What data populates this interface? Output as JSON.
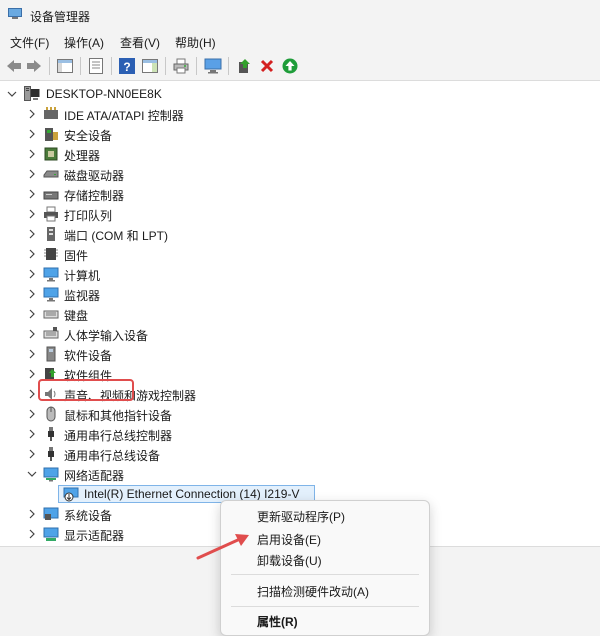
{
  "window": {
    "title": "设备管理器"
  },
  "menu": {
    "file": "文件(F)",
    "action": "操作(A)",
    "view": "查看(V)",
    "help": "帮助(H)"
  },
  "tree": {
    "root": "DESKTOP-NN0EE8K",
    "items": [
      {
        "label": "IDE ATA/ATAPI 控制器",
        "icon": "ide-controller-icon"
      },
      {
        "label": "安全设备",
        "icon": "security-device-icon"
      },
      {
        "label": "处理器",
        "icon": "processor-icon"
      },
      {
        "label": "磁盘驱动器",
        "icon": "disk-drive-icon"
      },
      {
        "label": "存储控制器",
        "icon": "storage-controller-icon"
      },
      {
        "label": "打印队列",
        "icon": "printer-icon"
      },
      {
        "label": "端口 (COM 和 LPT)",
        "icon": "port-icon"
      },
      {
        "label": "固件",
        "icon": "firmware-icon"
      },
      {
        "label": "计算机",
        "icon": "computer-icon"
      },
      {
        "label": "监视器",
        "icon": "monitor-icon"
      },
      {
        "label": "键盘",
        "icon": "keyboard-icon"
      },
      {
        "label": "人体学输入设备",
        "icon": "hid-icon"
      },
      {
        "label": "软件设备",
        "icon": "software-device-icon"
      },
      {
        "label": "软件组件",
        "icon": "software-component-icon"
      },
      {
        "label": "声音、视频和游戏控制器",
        "icon": "sound-icon"
      },
      {
        "label": "鼠标和其他指针设备",
        "icon": "mouse-icon"
      },
      {
        "label": "通用串行总线控制器",
        "icon": "usb-icon"
      },
      {
        "label": "通用串行总线设备",
        "icon": "usb-icon"
      },
      {
        "label": "网络适配器",
        "icon": "network-adapter-icon",
        "expanded": true
      },
      {
        "label": "Intel(R) Ethernet Connection (14) I219-V",
        "icon": "disabled-network-device-icon",
        "child": true,
        "selected": true
      },
      {
        "label": "系统设备",
        "icon": "system-device-icon"
      },
      {
        "label": "显示适配器",
        "icon": "display-adapter-icon"
      }
    ]
  },
  "context_menu": {
    "update_driver": "更新驱动程序(P)",
    "enable_device": "启用设备(E)",
    "uninstall_device": "卸载设备(U)",
    "scan_hardware": "扫描检测硬件改动(A)",
    "properties": "属性(R)"
  },
  "colors": {
    "highlight_box": "#e04d4d",
    "arrow": "#e04d4d",
    "selection": "#e3f0fc",
    "accent_blue": "#2b79d6"
  }
}
